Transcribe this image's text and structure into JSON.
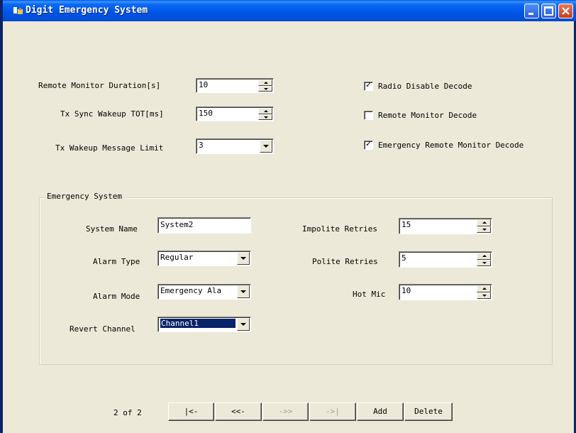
{
  "window": {
    "title": "Digit Emergency System"
  },
  "top": {
    "remote_monitor_duration": {
      "label": "Remote Monitor Duration[s]",
      "value": "10"
    },
    "tx_sync_wakeup_tot": {
      "label": "Tx Sync Wakeup TOT[ms]",
      "value": "150"
    },
    "tx_wakeup_message_limit": {
      "label": "Tx Wakeup Message Limit",
      "value": "3"
    },
    "checks": [
      {
        "label": "Radio Disable Decode",
        "checked": true
      },
      {
        "label": "Remote Monitor Decode",
        "checked": false
      },
      {
        "label": "Emergency Remote Monitor Decode",
        "checked": true
      }
    ]
  },
  "group": {
    "title": "Emergency System",
    "system_name": {
      "label": "System Name",
      "value": "System2"
    },
    "alarm_type": {
      "label": "Alarm Type",
      "value": "Regular"
    },
    "alarm_mode": {
      "label": "Alarm Mode",
      "value": "Emergency Ala"
    },
    "revert_channel": {
      "label": "Revert Channel",
      "value": "Channel1"
    },
    "impolite_retries": {
      "label": "Impolite Retries",
      "value": "15"
    },
    "polite_retries": {
      "label": "Polite Retries",
      "value": "5"
    },
    "hot_mic": {
      "label": "Hot Mic",
      "value": "10"
    }
  },
  "nav": {
    "record": "2 of 2",
    "first": "|<-",
    "prev": "<<-",
    "next": "->>",
    "last": "->|",
    "add": "Add",
    "delete": "Delete"
  },
  "colors": {
    "titlebar": "#0054e3",
    "face": "#ece9d8",
    "selection": "#0a246a"
  }
}
